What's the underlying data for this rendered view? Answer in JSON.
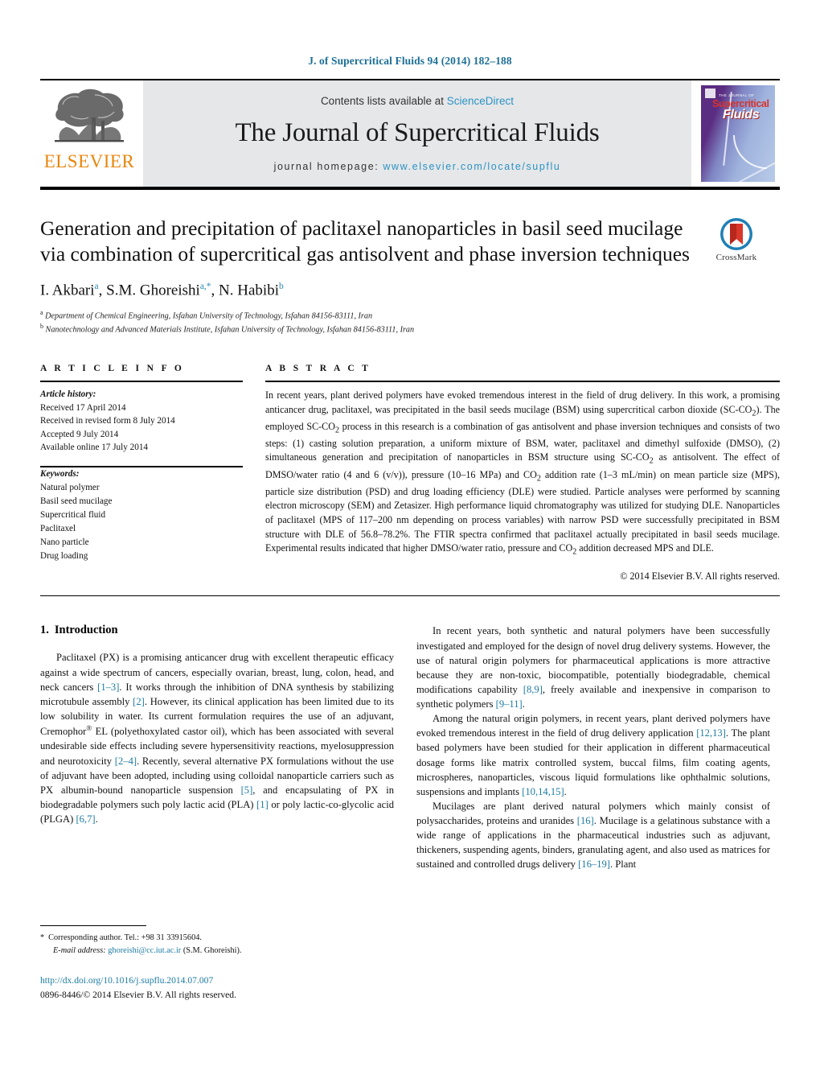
{
  "running_head": "J. of Supercritical Fluids 94 (2014) 182–188",
  "masthead": {
    "publisher_logo_text": "ELSEVIER",
    "contents_prefix": "Contents lists available at ",
    "contents_link": "ScienceDirect",
    "journal_title": "The Journal of Supercritical Fluids",
    "homepage_prefix": "journal homepage:",
    "homepage_url": "www.elsevier.com/locate/supflu",
    "cover": {
      "line1": "THE JOURNAL OF",
      "line2": "Supercritical",
      "line3": "Fluids"
    },
    "colors": {
      "link_blue": "#2b93c4",
      "elsevier_orange": "#E8860C",
      "band_gray": "#e6e7e9"
    }
  },
  "article": {
    "title": "Generation and precipitation of paclitaxel nanoparticles in basil seed mucilage via combination of supercritical gas antisolvent and phase inversion techniques",
    "authors_html": "I. Akbari<sup>a</sup>, S.M. Ghoreishi<sup>a,*</sup>, N. Habibi<sup>b</sup>",
    "affiliations": [
      "Department of Chemical Engineering, Isfahan University of Technology, Isfahan 84156-83111, Iran",
      "Nanotechnology and Advanced Materials Institute, Isfahan University of Technology, Isfahan 84156-83111, Iran"
    ],
    "crossmark_label": "CrossMark"
  },
  "article_info": {
    "heading": "A R T I C L E   I N F O",
    "history_label": "Article history:",
    "history": [
      "Received 17 April 2014",
      "Received in revised form 8 July 2014",
      "Accepted 9 July 2014",
      "Available online 17 July 2014"
    ],
    "keywords_label": "Keywords:",
    "keywords": [
      "Natural polymer",
      "Basil seed mucilage",
      "Supercritical fluid",
      "Paclitaxel",
      "Nano particle",
      "Drug loading"
    ]
  },
  "abstract": {
    "heading": "A B S T R A C T",
    "text_html": "In recent years, plant derived polymers have evoked tremendous interest in the field of drug delivery. In this work, a promising anticancer drug, paclitaxel, was precipitated in the basil seeds mucilage (BSM) using supercritical carbon dioxide (SC-CO<sub>2</sub>). The employed SC-CO<sub>2</sub> process in this research is a combination of gas antisolvent and phase inversion techniques and consists of two steps: (1) casting solution preparation, a uniform mixture of BSM, water, paclitaxel and dimethyl sulfoxide (DMSO), (2) simultaneous generation and precipitation of nanoparticles in BSM structure using SC-CO<sub>2</sub> as antisolvent. The effect of DMSO/water ratio (4 and 6 (v/v)), pressure (10–16 MPa) and CO<sub>2</sub> addition rate (1–3 mL/min) on mean particle size (MPS), particle size distribution (PSD) and drug loading efficiency (DLE) were studied. Particle analyses were performed by scanning electron microscopy (SEM) and Zetasizer. High performance liquid chromatography was utilized for studying DLE. Nanoparticles of paclitaxel (MPS of 117–200 nm depending on process variables) with narrow PSD were successfully precipitated in BSM structure with DLE of 56.8–78.2%. The FTIR spectra confirmed that paclitaxel actually precipitated in basil seeds mucilage. Experimental results indicated that higher DMSO/water ratio, pressure and CO<sub>2</sub> addition decreased MPS and DLE.",
    "copyright": "© 2014 Elsevier B.V. All rights reserved."
  },
  "introduction": {
    "heading_number": "1.",
    "heading_text": "Introduction",
    "left_paragraphs_html": [
      "Paclitaxel (PX) is a promising anticancer drug with excellent therapeutic efficacy against a wide spectrum of cancers, especially ovarian, breast, lung, colon, head, and neck cancers <span class=\"ref\">[1–3]</span>. It works through the inhibition of DNA synthesis by stabilizing microtubule assembly <span class=\"ref\">[2]</span>. However, its clinical application has been limited due to its low solubility in water. Its current formulation requires the use of an adjuvant, Cremophor<span class=\"sup-small\">®</span> EL (polyethoxylated castor oil), which has been associated with several undesirable side effects including severe hypersensitivity reactions, myelosuppression and neurotoxicity <span class=\"ref\">[2–4]</span>. Recently, several alternative PX formulations without the use of adjuvant have been adopted, including using colloidal nanoparticle carriers such as PX albumin-bound nanoparticle suspension <span class=\"ref\">[5]</span>, and encapsulating of PX in biodegradable polymers such poly lactic acid (PLA) <span class=\"ref\">[1]</span> or poly lactic-co-glycolic acid (PLGA) <span class=\"ref\">[6,7]</span>."
    ],
    "right_paragraphs_html": [
      "In recent years, both synthetic and natural polymers have been successfully investigated and employed for the design of novel drug delivery systems. However, the use of natural origin polymers for pharmaceutical applications is more attractive because they are non-toxic, biocompatible, potentially biodegradable, chemical modifications capability <span class=\"ref\">[8,9]</span>, freely available and inexpensive in comparison to synthetic polymers <span class=\"ref\">[9–11]</span>.",
      "Among the natural origin polymers, in recent years, plant derived polymers have evoked tremendous interest in the field of drug delivery application <span class=\"ref\">[12,13]</span>. The plant based polymers have been studied for their application in different pharmaceutical dosage forms like matrix controlled system, buccal films, film coating agents, microspheres, nanoparticles, viscous liquid formulations like ophthalmic solutions, suspensions and implants <span class=\"ref\">[10,14,15]</span>.",
      "Mucilages are plant derived natural polymers which mainly consist of polysaccharides, proteins and uranides <span class=\"ref\">[16]</span>. Mucilage is a gelatinous substance with a wide range of applications in the pharmaceutical industries such as adjuvant, thickeners, suspending agents, binders, granulating agent, and also used as matrices for sustained and controlled drugs delivery <span class=\"ref\">[16–19]</span>. Plant"
    ]
  },
  "footnote": {
    "star": "*",
    "corresponding": "Corresponding author. Tel.: +98 31 33915604.",
    "email_label": "E-mail address:",
    "email": "ghoreishi@cc.iut.ac.ir",
    "email_suffix": "(S.M. Ghoreishi)."
  },
  "footer": {
    "doi": "http://dx.doi.org/10.1016/j.supflu.2014.07.007",
    "issn_line": "0896-8446/© 2014 Elsevier B.V. All rights reserved."
  }
}
